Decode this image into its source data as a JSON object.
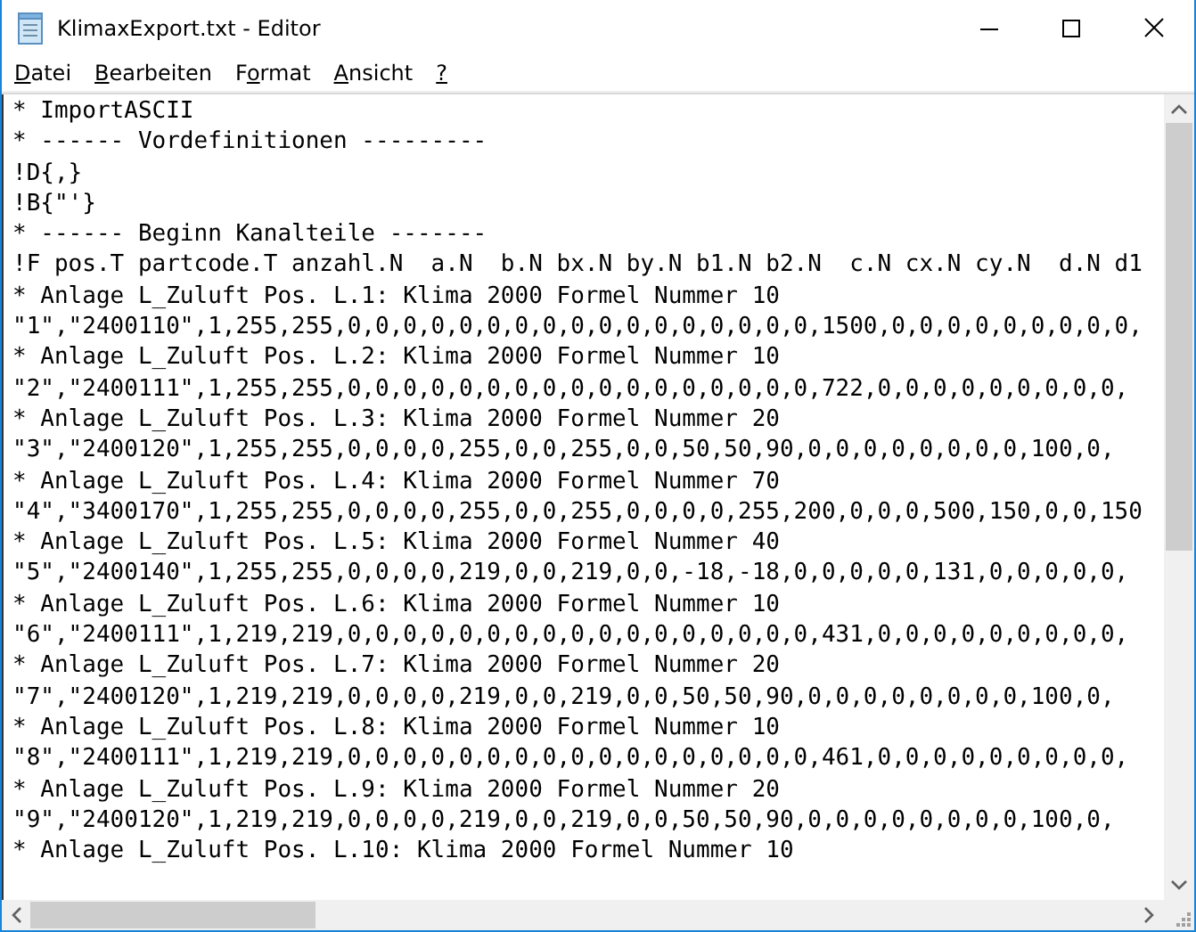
{
  "window": {
    "title": "KlimaxExport.txt - Editor"
  },
  "menu": [
    {
      "access_key": "D",
      "text_after": "atei"
    },
    {
      "access_key": "B",
      "text_after": "earbeiten"
    },
    {
      "text_before": "F",
      "access_key": "o",
      "text_after": "rmat"
    },
    {
      "access_key": "A",
      "text_after": "nsicht"
    },
    {
      "access_key": "?"
    }
  ],
  "editor": {
    "lines": [
      "* ImportASCII",
      "* ------ Vordefinitionen ---------",
      "!D{,}",
      "!B{\"'}",
      "* ------ Beginn Kanalteile -------",
      "!F pos.T partcode.T anzahl.N  a.N  b.N bx.N by.N b1.N b2.N  c.N cx.N cy.N  d.N d1",
      "* Anlage L_Zuluft Pos. L.1: Klima 2000 Formel Nummer 10",
      "\"1\",\"2400110\",1,255,255,0,0,0,0,0,0,0,0,0,0,0,0,0,0,0,0,0,1500,0,0,0,0,0,0,0,0,0,",
      "* Anlage L_Zuluft Pos. L.2: Klima 2000 Formel Nummer 10",
      "\"2\",\"2400111\",1,255,255,0,0,0,0,0,0,0,0,0,0,0,0,0,0,0,0,0,722,0,0,0,0,0,0,0,0,0,",
      "* Anlage L_Zuluft Pos. L.3: Klima 2000 Formel Nummer 20",
      "\"3\",\"2400120\",1,255,255,0,0,0,0,255,0,0,255,0,0,50,50,90,0,0,0,0,0,0,0,0,100,0,",
      "* Anlage L_Zuluft Pos. L.4: Klima 2000 Formel Nummer 70",
      "\"4\",\"3400170\",1,255,255,0,0,0,0,255,0,0,255,0,0,0,0,255,200,0,0,0,500,150,0,0,150",
      "* Anlage L_Zuluft Pos. L.5: Klima 2000 Formel Nummer 40",
      "\"5\",\"2400140\",1,255,255,0,0,0,0,219,0,0,219,0,0,-18,-18,0,0,0,0,0,131,0,0,0,0,0,",
      "* Anlage L_Zuluft Pos. L.6: Klima 2000 Formel Nummer 10",
      "\"6\",\"2400111\",1,219,219,0,0,0,0,0,0,0,0,0,0,0,0,0,0,0,0,0,431,0,0,0,0,0,0,0,0,0,",
      "* Anlage L_Zuluft Pos. L.7: Klima 2000 Formel Nummer 20",
      "\"7\",\"2400120\",1,219,219,0,0,0,0,219,0,0,219,0,0,50,50,90,0,0,0,0,0,0,0,0,100,0,",
      "* Anlage L_Zuluft Pos. L.8: Klima 2000 Formel Nummer 10",
      "\"8\",\"2400111\",1,219,219,0,0,0,0,0,0,0,0,0,0,0,0,0,0,0,0,0,461,0,0,0,0,0,0,0,0,0,",
      "* Anlage L_Zuluft Pos. L.9: Klima 2000 Formel Nummer 20",
      "\"9\",\"2400120\",1,219,219,0,0,0,0,219,0,0,219,0,0,50,50,90,0,0,0,0,0,0,0,0,100,0,",
      "* Anlage L_Zuluft Pos. L.10: Klima 2000 Formel Nummer 10"
    ]
  }
}
